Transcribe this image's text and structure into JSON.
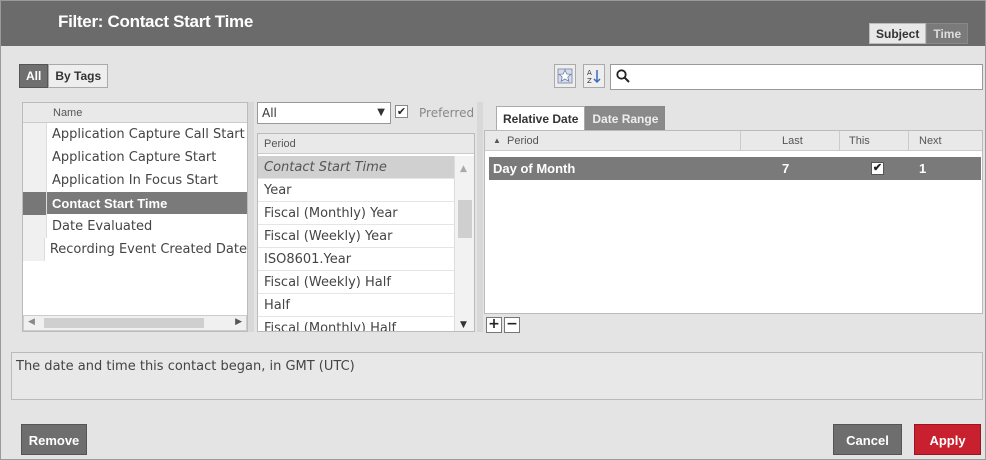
{
  "dialog": {
    "title": "Filter: Contact Start Time",
    "mode_toggle": [
      "Subject",
      "Time"
    ]
  },
  "tag_toggle": [
    "All",
    "By Tags"
  ],
  "search": {
    "placeholder": ""
  },
  "fields": {
    "header": "Name",
    "items": [
      "Application Capture Call Start",
      "Application Capture Start",
      "Application In Focus Start",
      "Contact Start Time",
      "Date Evaluated",
      "Recording Event Created Date"
    ],
    "selected_index": 3
  },
  "period_filter": {
    "dropdown_value": "All",
    "preferred_label": "Preferred",
    "preferred_checked": true
  },
  "periods": {
    "header": "Period",
    "items": [
      "Contact Start Time",
      "Year",
      "Fiscal (Monthly) Year",
      "Fiscal (Weekly) Year",
      "ISO8601.Year",
      "Fiscal (Weekly) Half",
      "Half",
      "Fiscal (Monthly) Half"
    ]
  },
  "date_tabs": [
    "Relative Date",
    "Date Range"
  ],
  "relative": {
    "columns": {
      "period": "Period",
      "last": "Last",
      "this": "This",
      "next": "Next"
    },
    "rows": [
      {
        "period": "Day of Month",
        "last": "7",
        "this": true,
        "next": "1"
      }
    ]
  },
  "row_buttons": {
    "add": "+",
    "remove": "−"
  },
  "description": "The date and time this contact began, in GMT (UTC)",
  "footer": {
    "remove": "Remove",
    "cancel": "Cancel",
    "apply": "Apply"
  },
  "colors": {
    "accent": "#c8202e",
    "titlebar": "#6b6b6b",
    "selection": "#7a7a7a"
  }
}
